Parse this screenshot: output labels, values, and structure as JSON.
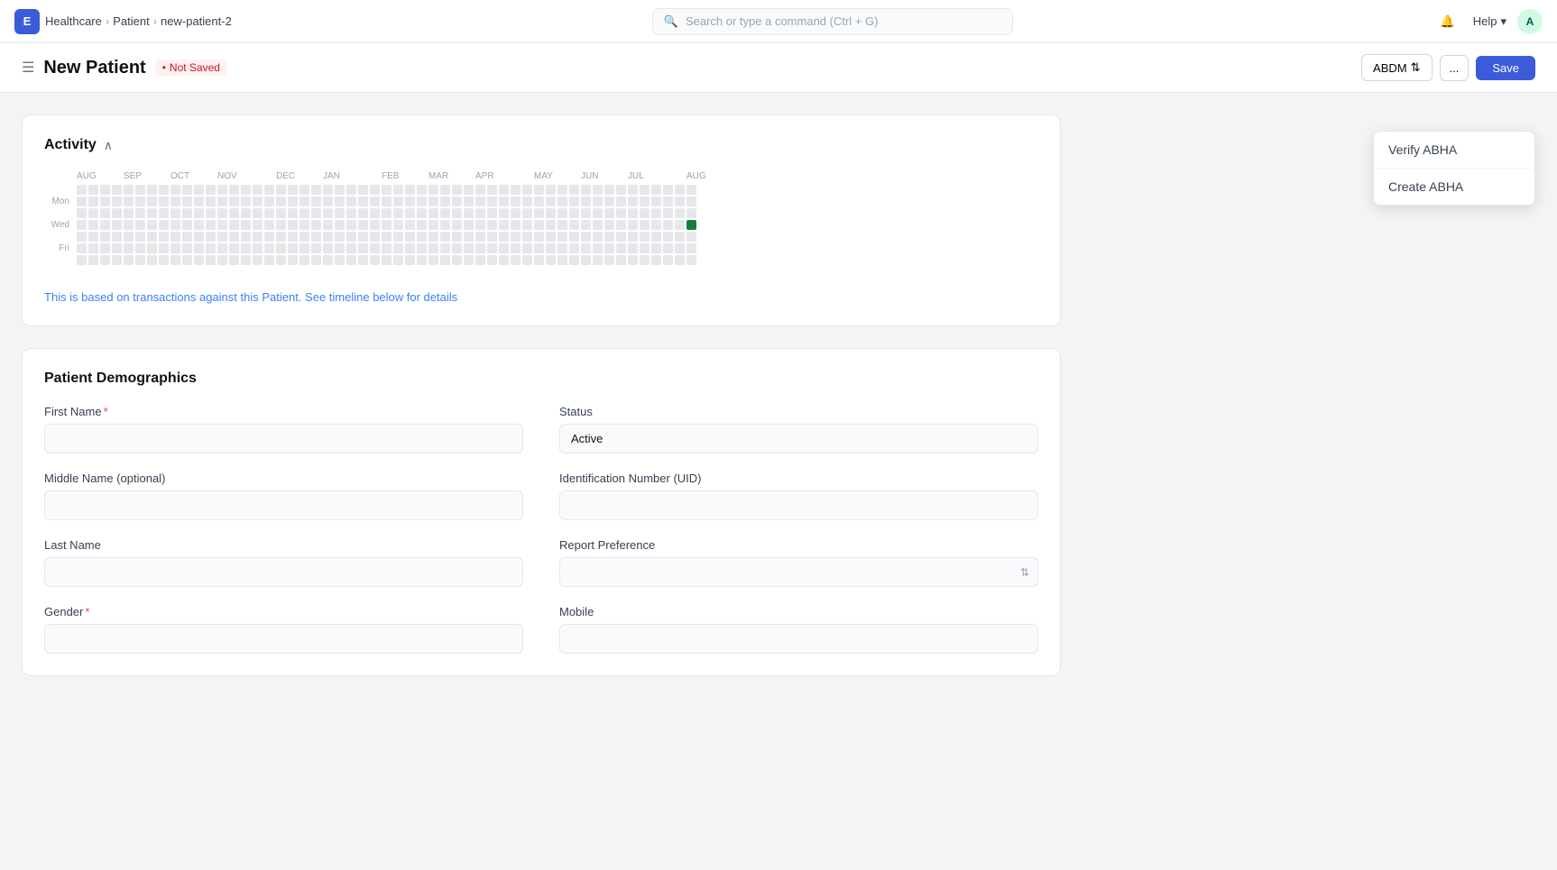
{
  "topnav": {
    "app_icon": "E",
    "breadcrumbs": [
      "Healthcare",
      "Patient",
      "new-patient-2"
    ],
    "search_placeholder": "Search or type a command (Ctrl + G)",
    "help_label": "Help",
    "avatar_label": "A"
  },
  "page_header": {
    "title": "New Patient",
    "not_saved": "Not Saved",
    "abdm_label": "ABDM",
    "more_label": "...",
    "save_label": "Save"
  },
  "dropdown": {
    "items": [
      "Verify ABHA",
      "Create ABHA"
    ]
  },
  "activity": {
    "title": "Activity",
    "note": "This is based on transactions against this Patient. See timeline below for details",
    "months": [
      "AUG",
      "SEP",
      "OCT",
      "NOV",
      "DEC",
      "JAN",
      "FEB",
      "MAR",
      "APR",
      "MAY",
      "JUN",
      "JUL",
      "AUG"
    ],
    "day_labels": [
      "",
      "Mon",
      "",
      "Wed",
      "",
      "Fri",
      ""
    ]
  },
  "demographics": {
    "title": "Patient Demographics",
    "fields": {
      "first_name_label": "First Name",
      "first_name_required": true,
      "middle_name_label": "Middle Name (optional)",
      "last_name_label": "Last Name",
      "gender_label": "Gender",
      "gender_required": true,
      "status_label": "Status",
      "status_value": "Active",
      "uid_label": "Identification Number (UID)",
      "report_pref_label": "Report Preference",
      "mobile_label": "Mobile"
    }
  }
}
